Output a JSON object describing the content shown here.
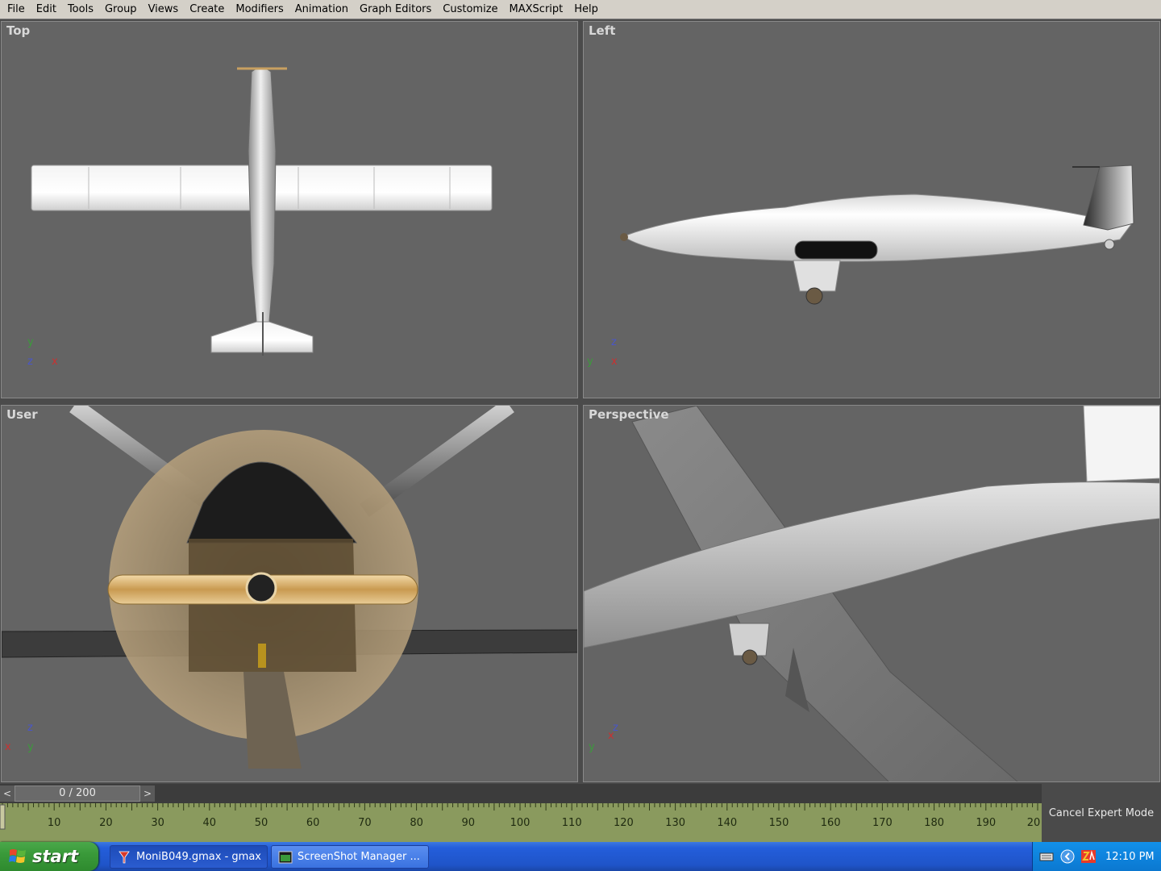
{
  "menu": [
    "File",
    "Edit",
    "Tools",
    "Group",
    "Views",
    "Create",
    "Modifiers",
    "Animation",
    "Graph Editors",
    "Customize",
    "MAXScript",
    "Help"
  ],
  "viewports": {
    "top": {
      "label": "Top",
      "axis": [
        "y",
        "z",
        "x"
      ]
    },
    "left": {
      "label": "Left",
      "axis": [
        "z",
        "y",
        "x"
      ]
    },
    "user": {
      "label": "User",
      "axis": [
        "z",
        "x",
        "y"
      ]
    },
    "perspective": {
      "label": "Perspective",
      "axis": [
        "z",
        "y",
        "x"
      ]
    }
  },
  "timeline": {
    "prev_label": "<",
    "next_label": ">",
    "frame_display": "0 / 200",
    "ticks": [
      "10",
      "20",
      "30",
      "40",
      "50",
      "60",
      "70",
      "80",
      "90",
      "100",
      "110",
      "120",
      "130",
      "140",
      "150",
      "160",
      "170",
      "180",
      "190",
      "20"
    ]
  },
  "cancel_expert_mode": "Cancel Expert Mode",
  "taskbar": {
    "start_label": "start",
    "tasks": [
      {
        "label": "MoniB049.gmax - gmax",
        "icon": "gmax-icon"
      },
      {
        "label": "ScreenShot Manager ...",
        "icon": "screenshot-manager-icon"
      }
    ],
    "clock": "12:10 PM"
  },
  "colors": {
    "viewport_bg": "#646464",
    "menu_bg": "#d4d0c8",
    "track_bg": "#8a9a5e",
    "taskbar_blue": "#245edb",
    "start_green": "#3a9a3a"
  }
}
